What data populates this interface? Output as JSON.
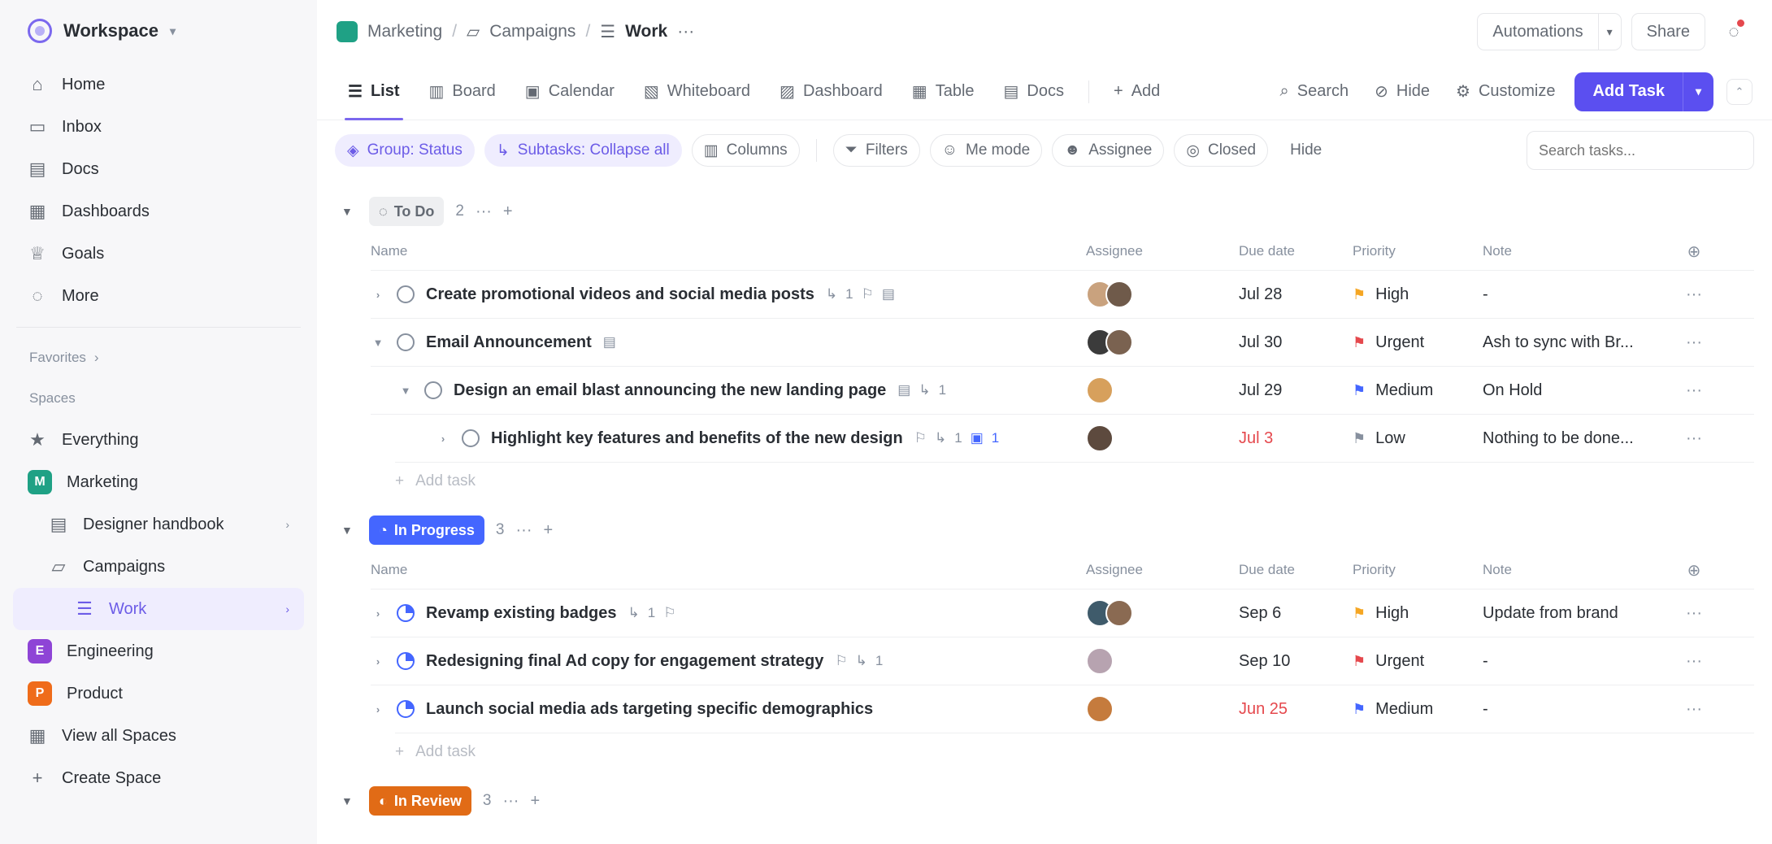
{
  "workspace": {
    "name": "Workspace"
  },
  "sidebar": {
    "nav": [
      {
        "label": "Home",
        "icon": "home-icon"
      },
      {
        "label": "Inbox",
        "icon": "inbox-icon"
      },
      {
        "label": "Docs",
        "icon": "docs-icon"
      },
      {
        "label": "Dashboards",
        "icon": "dashboards-icon"
      },
      {
        "label": "Goals",
        "icon": "goals-icon"
      },
      {
        "label": "More",
        "icon": "more-icon"
      }
    ],
    "favorites_label": "Favorites",
    "spaces_label": "Spaces",
    "everything_label": "Everything",
    "marketing": {
      "label": "Marketing",
      "initial": "M",
      "color": "#1fa185"
    },
    "designer_handbook": "Designer handbook",
    "campaigns": "Campaigns",
    "work": "Work",
    "engineering": {
      "label": "Engineering",
      "initial": "E",
      "color": "#8e44d6"
    },
    "product": {
      "label": "Product",
      "initial": "P",
      "color": "#ef6c1a"
    },
    "view_all": "View all Spaces",
    "create_space": "Create Space"
  },
  "breadcrumb": {
    "space": "Marketing",
    "folder": "Campaigns",
    "list": "Work"
  },
  "header": {
    "automations": "Automations",
    "share": "Share"
  },
  "views": {
    "tabs": [
      "List",
      "Board",
      "Calendar",
      "Whiteboard",
      "Dashboard",
      "Table",
      "Docs"
    ],
    "add": "Add",
    "search": "Search",
    "hide": "Hide",
    "customize": "Customize",
    "add_task": "Add Task"
  },
  "filters": {
    "group": "Group: Status",
    "subtasks": "Subtasks: Collapse all",
    "columns": "Columns",
    "filters": "Filters",
    "me_mode": "Me mode",
    "assignee": "Assignee",
    "closed": "Closed",
    "hide": "Hide",
    "search_placeholder": "Search tasks..."
  },
  "columns": {
    "name": "Name",
    "assignee": "Assignee",
    "due": "Due date",
    "priority": "Priority",
    "note": "Note"
  },
  "add_task_label": "Add task",
  "groups": [
    {
      "status": "To Do",
      "count": "2",
      "tasks": [
        {
          "name": "Create promotional videos and social media posts",
          "meta": "1",
          "due": "Jul 28",
          "priority": "High",
          "note": "-"
        },
        {
          "name": "Email Announcement",
          "due": "Jul 30",
          "priority": "Urgent",
          "note": "Ash to sync with Br..."
        },
        {
          "name": "Design an email blast announcing the new landing page",
          "meta": "1",
          "due": "Jul 29",
          "priority": "Medium",
          "note": "On Hold"
        },
        {
          "name": "Highlight key features and benefits of the new design",
          "meta": "1",
          "meta2": "1",
          "due": "Jul 3",
          "priority": "Low",
          "note": "Nothing to be done..."
        }
      ]
    },
    {
      "status": "In Progress",
      "count": "3",
      "tasks": [
        {
          "name": "Revamp existing badges",
          "meta": "1",
          "due": "Sep 6",
          "priority": "High",
          "note": "Update from brand"
        },
        {
          "name": "Redesigning final Ad copy for engagement strategy",
          "meta": "1",
          "due": "Sep 10",
          "priority": "Urgent",
          "note": "-"
        },
        {
          "name": "Launch social media ads targeting specific demographics",
          "due": "Jun 25",
          "priority": "Medium",
          "note": "-"
        }
      ]
    },
    {
      "status": "In Review",
      "count": "3"
    }
  ],
  "colors": {
    "accent": "#7b68ee",
    "primary_button": "#5b4ff0",
    "high": "#f5a623",
    "urgent": "#e5484d",
    "medium": "#4466ff",
    "low": "#87909e",
    "in_progress": "#4466ff",
    "in_review": "#e16b16"
  }
}
